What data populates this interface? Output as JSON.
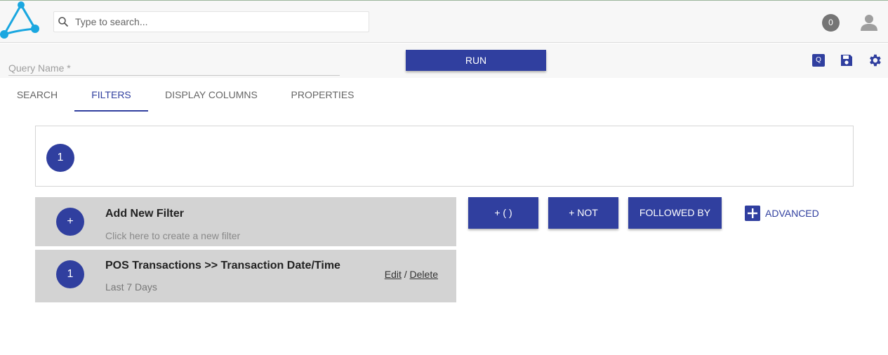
{
  "header": {
    "search_placeholder": "Type to search...",
    "notification_count": "0"
  },
  "query": {
    "name_placeholder": "Query Name *",
    "run_label": "RUN",
    "q_badge": "Q"
  },
  "tabs": [
    {
      "label": "SEARCH",
      "active": false
    },
    {
      "label": "FILTERS",
      "active": true
    },
    {
      "label": "DISPLAY COLUMNS",
      "active": false
    },
    {
      "label": "PROPERTIES",
      "active": false
    }
  ],
  "sequence": {
    "step_number": "1"
  },
  "add_filter": {
    "icon_symbol": "+",
    "title": "Add New Filter",
    "subtitle": "Click here to create a new filter"
  },
  "filters": [
    {
      "number": "1",
      "title": "POS Transactions >> Transaction Date/Time",
      "subtitle": "Last 7 Days",
      "edit_label": "Edit",
      "separator": "/",
      "delete_label": "Delete"
    }
  ],
  "operators": {
    "group_label": "+ ( )",
    "not_label": "+ NOT",
    "followed_by_label": "FOLLOWED BY",
    "advanced_label": "ADVANCED"
  },
  "colors": {
    "primary": "#303f9f",
    "logo": "#1aa7e0",
    "card_bg": "#d3d3d3"
  }
}
